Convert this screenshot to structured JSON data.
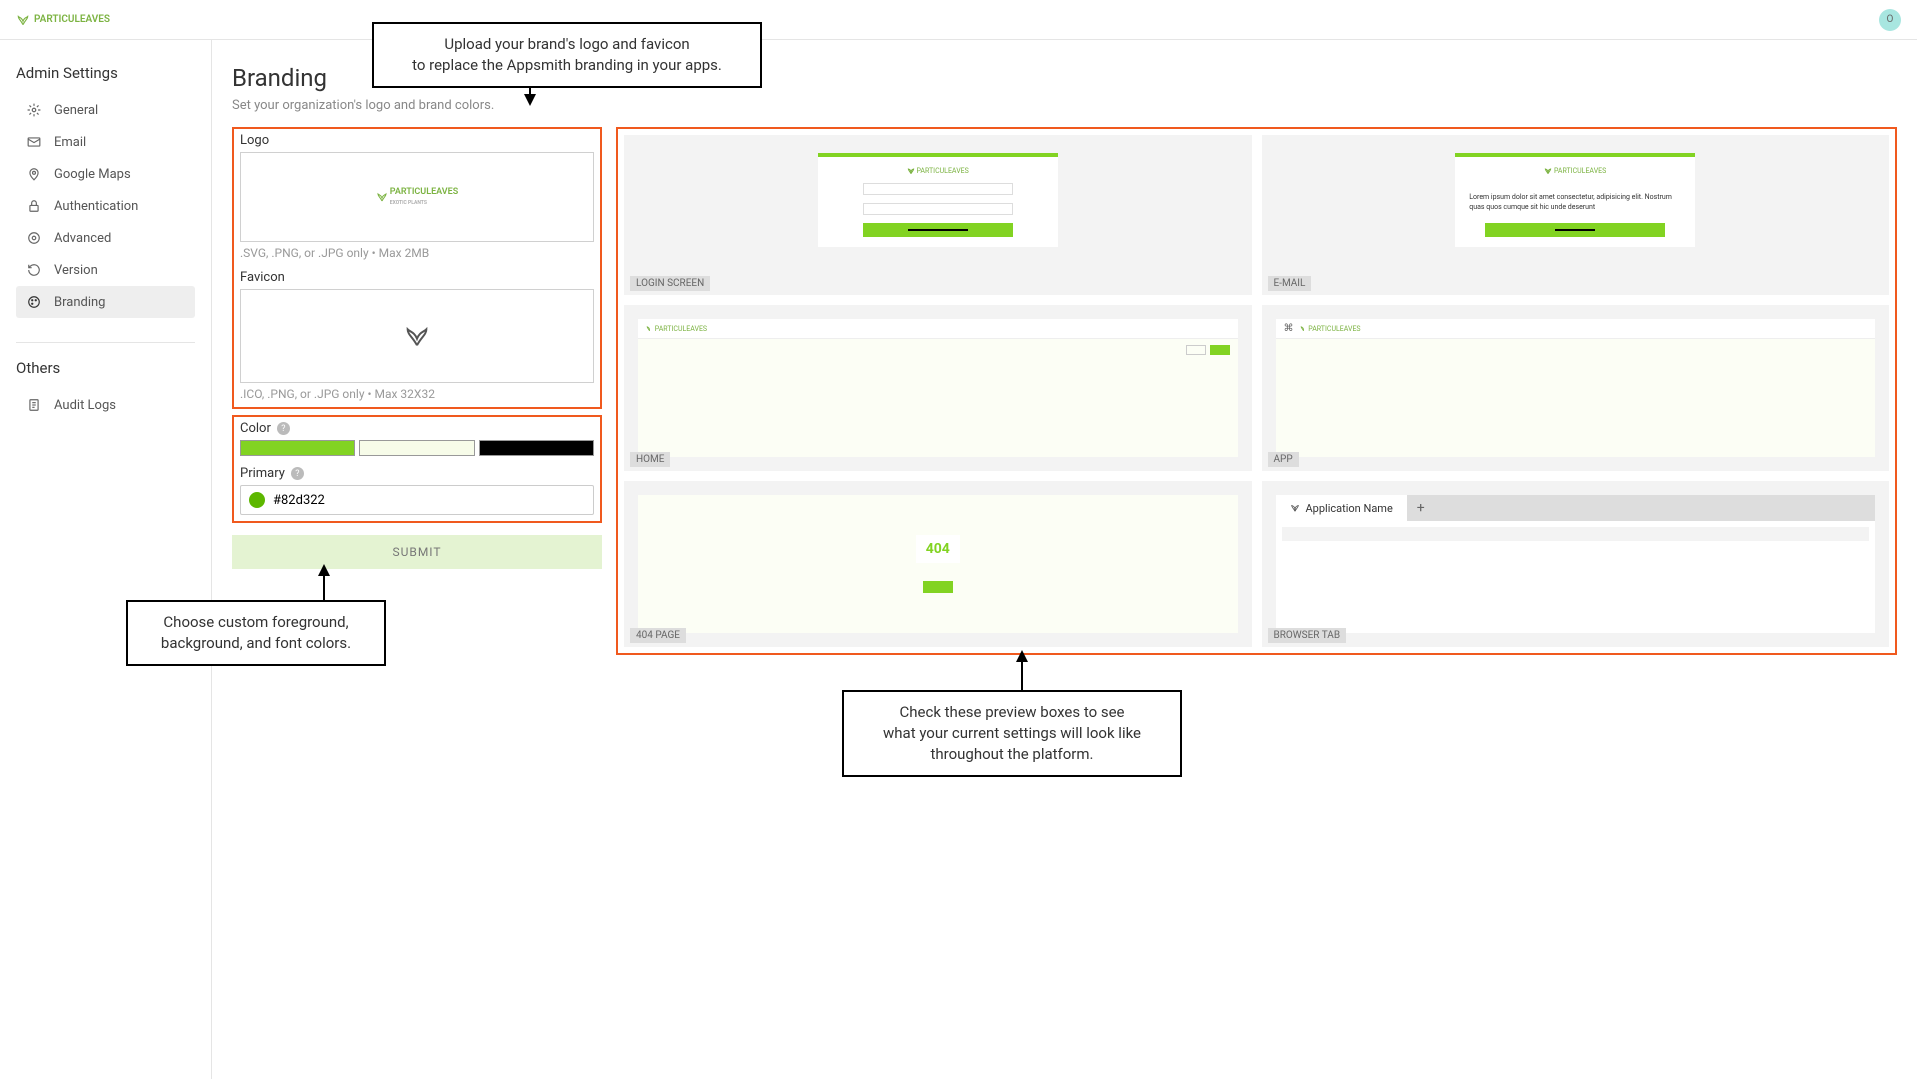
{
  "brand_name": "PARTICULEAVES",
  "brand_tagline": "EXOTIC PLANTS",
  "avatar_initial": "O",
  "sidebar": {
    "section1_title": "Admin Settings",
    "section2_title": "Others",
    "items": [
      {
        "label": "General"
      },
      {
        "label": "Email"
      },
      {
        "label": "Google Maps"
      },
      {
        "label": "Authentication"
      },
      {
        "label": "Advanced"
      },
      {
        "label": "Version"
      },
      {
        "label": "Branding"
      }
    ],
    "others": [
      {
        "label": "Audit Logs"
      }
    ]
  },
  "page": {
    "title": "Branding",
    "subtitle": "Set your organization's logo and brand colors."
  },
  "form": {
    "logo_label": "Logo",
    "logo_hint": ".SVG, .PNG, or .JPG only • Max 2MB",
    "favicon_label": "Favicon",
    "favicon_hint": ".ICO, .PNG, or .JPG only • Max 32X32",
    "color_label": "Color",
    "primary_label": "Primary",
    "primary_value": "#82d322",
    "colors": {
      "primary": "#82d322",
      "background": "#f7fce9",
      "font": "#000000"
    },
    "submit_label": "SUBMIT"
  },
  "previews": {
    "login": "LOGIN SCREEN",
    "email": "E-MAIL",
    "home": "HOME",
    "app": "APP",
    "404": "404 PAGE",
    "browser": "BROWSER TAB",
    "404_text": "404",
    "app_name": "Application Name",
    "lorem": "Lorem ipsum dolor sit amet consectetur, adipisicing elit. Nostrum quas quos cumque sit hic unde deserunt"
  },
  "callouts": {
    "top": "Upload your brand's logo and favicon\nto replace the Appsmith branding in your apps.",
    "left": "Choose custom foreground,\nbackground, and font colors.",
    "bottom": "Check these preview boxes to see\nwhat your current settings will look like\nthroughout the platform."
  }
}
